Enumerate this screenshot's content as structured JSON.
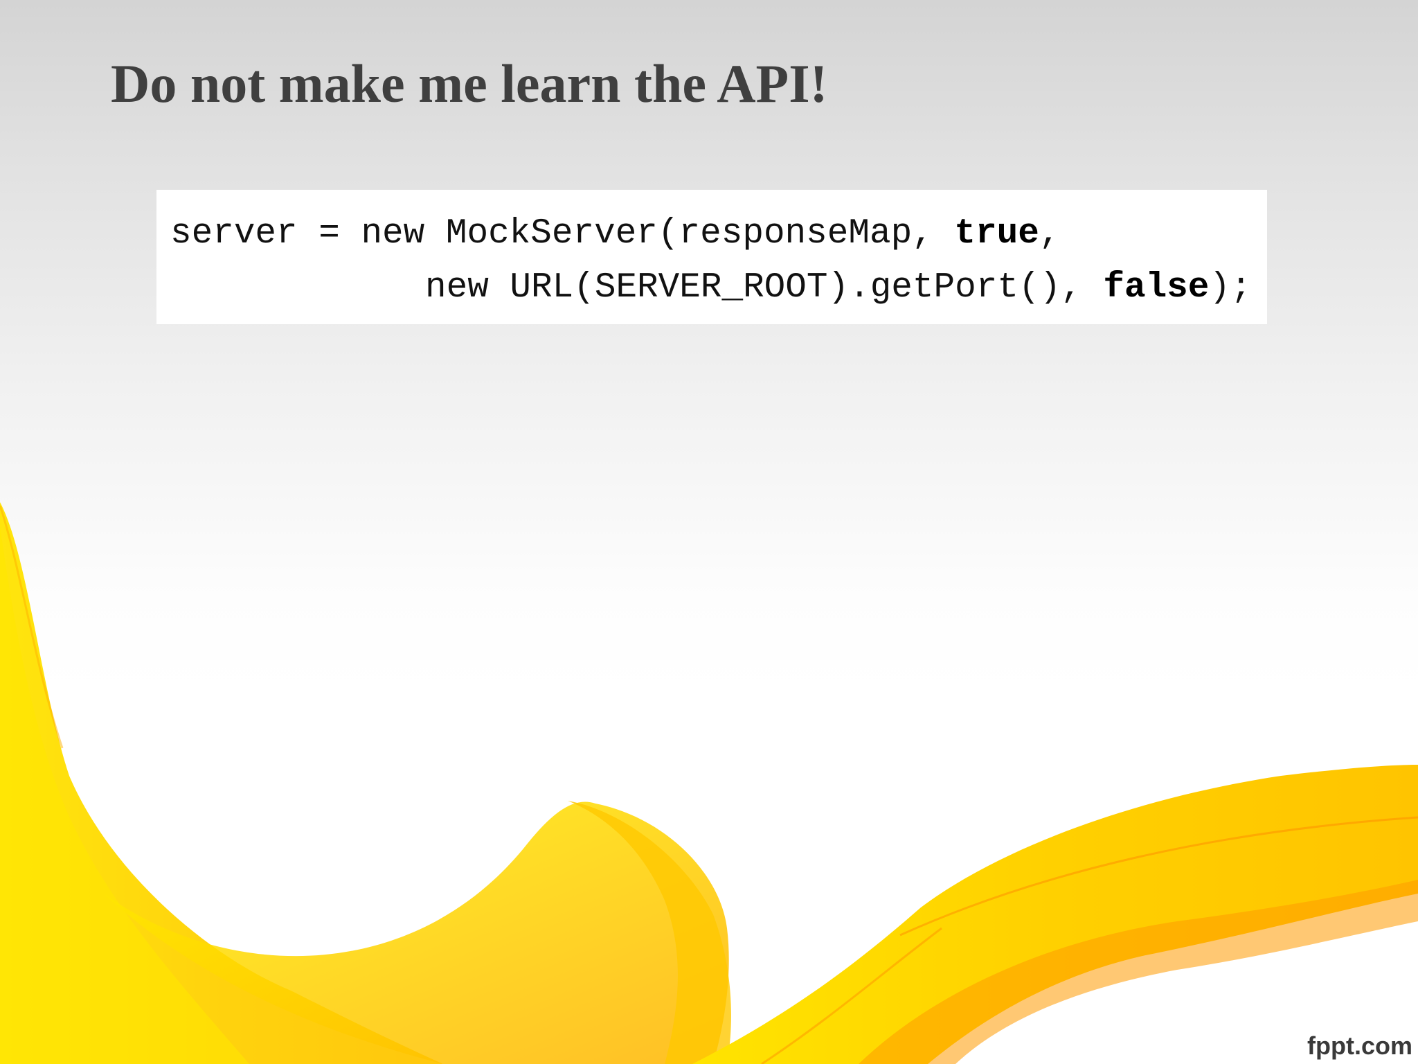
{
  "slide": {
    "title": "Do not make me learn the API!",
    "brand": "fppt.com",
    "accent_colors": [
      "#ffd400",
      "#ffb000",
      "#ff7a00"
    ]
  },
  "code": {
    "line1": {
      "before": "server = new MockServer(responseMap, ",
      "keyword": "true",
      "after": ","
    },
    "line2": {
      "before": "new URL(SERVER_ROOT).getPort(), ",
      "keyword": "false",
      "after": ");"
    }
  }
}
